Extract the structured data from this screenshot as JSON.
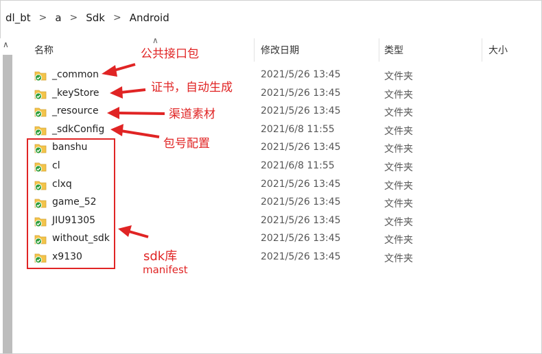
{
  "breadcrumb": [
    "dl_bt",
    "a",
    "Sdk",
    "Android"
  ],
  "columns": {
    "name": "名称",
    "modified": "修改日期",
    "type": "类型",
    "size": "大小"
  },
  "rows": [
    {
      "name": "_common",
      "modified": "2021/5/26 13:45",
      "type": "文件夹"
    },
    {
      "name": "_keyStore",
      "modified": "2021/5/26 13:45",
      "type": "文件夹"
    },
    {
      "name": "_resource",
      "modified": "2021/5/26 13:45",
      "type": "文件夹"
    },
    {
      "name": "_sdkConfig",
      "modified": "2021/6/8 11:55",
      "type": "文件夹"
    },
    {
      "name": "banshu",
      "modified": "2021/5/26 13:45",
      "type": "文件夹"
    },
    {
      "name": "cl",
      "modified": "2021/6/8 11:55",
      "type": "文件夹"
    },
    {
      "name": "clxq",
      "modified": "2021/5/26 13:45",
      "type": "文件夹"
    },
    {
      "name": "game_52",
      "modified": "2021/5/26 13:45",
      "type": "文件夹"
    },
    {
      "name": "JIU91305",
      "modified": "2021/5/26 13:45",
      "type": "文件夹"
    },
    {
      "name": "without_sdk",
      "modified": "2021/5/26 13:45",
      "type": "文件夹"
    },
    {
      "name": "x9130",
      "modified": "2021/5/26 13:45",
      "type": "文件夹"
    }
  ],
  "annotations": {
    "common": "公共接口包",
    "keystore": "证书，自动生成",
    "resource": "渠道素材",
    "sdkconfig": "包号配置",
    "sdk_line1": "sdk库",
    "sdk_line2": "manifest"
  },
  "colors": {
    "annotation": "#e02424",
    "folder": "#f3c44a",
    "sync_check": "#2e9e3a"
  }
}
